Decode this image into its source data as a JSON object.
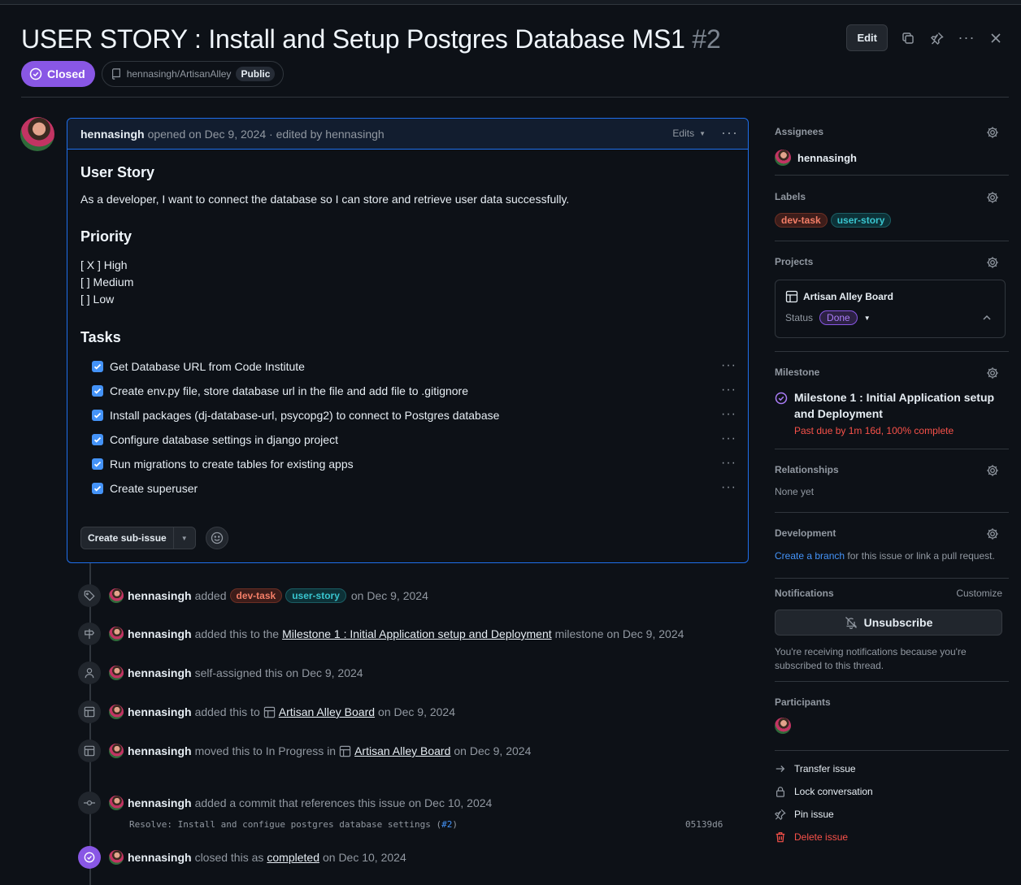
{
  "issue": {
    "title": "USER STORY : Install and Setup Postgres Database MS1",
    "number": "#2",
    "edit_label": "Edit",
    "state": "Closed",
    "repo": "hennasingh/ArtisanAlley",
    "visibility": "Public"
  },
  "comment": {
    "author": "hennasingh",
    "opened_text": "opened on Dec 9, 2024 · edited by hennasingh",
    "edits_label": "Edits",
    "h_user_story": "User Story",
    "story_text": "As a developer, I want to connect the database so I can store and retrieve user data successfully.",
    "h_priority": "Priority",
    "priority": [
      "[ X ] High",
      "[ ] Medium",
      "[ ] Low"
    ],
    "h_tasks": "Tasks",
    "tasks": [
      {
        "label": "Get Database URL from Code Institute",
        "checked": true
      },
      {
        "label": "Create env.py file, store database url in the file and add file to .gitignore",
        "checked": true
      },
      {
        "label": "Install packages (dj-database-url, psycopg2) to connect to Postgres database",
        "checked": true
      },
      {
        "label": "Configure database settings in django project",
        "checked": true
      },
      {
        "label": "Run migrations to create tables for existing apps",
        "checked": true
      },
      {
        "label": "Create superuser",
        "checked": true
      }
    ],
    "create_sub_issue": "Create sub-issue"
  },
  "timeline": {
    "e1": {
      "user": "hennasingh",
      "pre": "added",
      "label1": "dev-task",
      "label2": "user-story",
      "post": "on Dec 9, 2024"
    },
    "e2": {
      "user": "hennasingh",
      "pre": "added this to the",
      "link": "Milestone 1 : Initial Application setup and Deployment",
      "post": "milestone on Dec 9, 2024"
    },
    "e3": {
      "user": "hennasingh",
      "text": "self-assigned this on Dec 9, 2024"
    },
    "e4": {
      "user": "hennasingh",
      "pre": "added this to",
      "link": "Artisan Alley Board",
      "post": "on Dec 9, 2024"
    },
    "e5": {
      "user": "hennasingh",
      "pre": "moved this to In Progress in",
      "link": "Artisan Alley Board",
      "post": "on Dec 9, 2024"
    },
    "e6": {
      "user": "hennasingh",
      "text": "added a commit that references this issue on Dec 10, 2024",
      "commit_msg": "Resolve: Install and configue postgres database settings (",
      "commit_ref": "#2",
      "commit_close": ")",
      "sha": "05139d6"
    },
    "e7": {
      "user": "hennasingh",
      "pre": "closed this as",
      "link": "completed",
      "post": "on Dec 10, 2024"
    }
  },
  "sidebar": {
    "assignees_title": "Assignees",
    "assignee": "hennasingh",
    "labels_title": "Labels",
    "labels": [
      "dev-task",
      "user-story"
    ],
    "projects_title": "Projects",
    "project_name": "Artisan Alley Board",
    "status_label": "Status",
    "status_value": "Done",
    "milestone_title": "Milestone",
    "milestone_name": "Milestone 1 : Initial Application setup and Deployment",
    "milestone_due": "Past due by 1m 16d, 100% complete",
    "relationships_title": "Relationships",
    "relationships_value": "None yet",
    "development_title": "Development",
    "dev_link": "Create a branch",
    "dev_text": " for this issue or link a pull request.",
    "notifications_title": "Notifications",
    "customize": "Customize",
    "unsubscribe": "Unsubscribe",
    "notif_reason": "You're receiving notifications because you're subscribed to this thread.",
    "participants_title": "Participants",
    "actions": [
      "Transfer issue",
      "Lock conversation",
      "Pin issue",
      "Delete issue"
    ]
  }
}
